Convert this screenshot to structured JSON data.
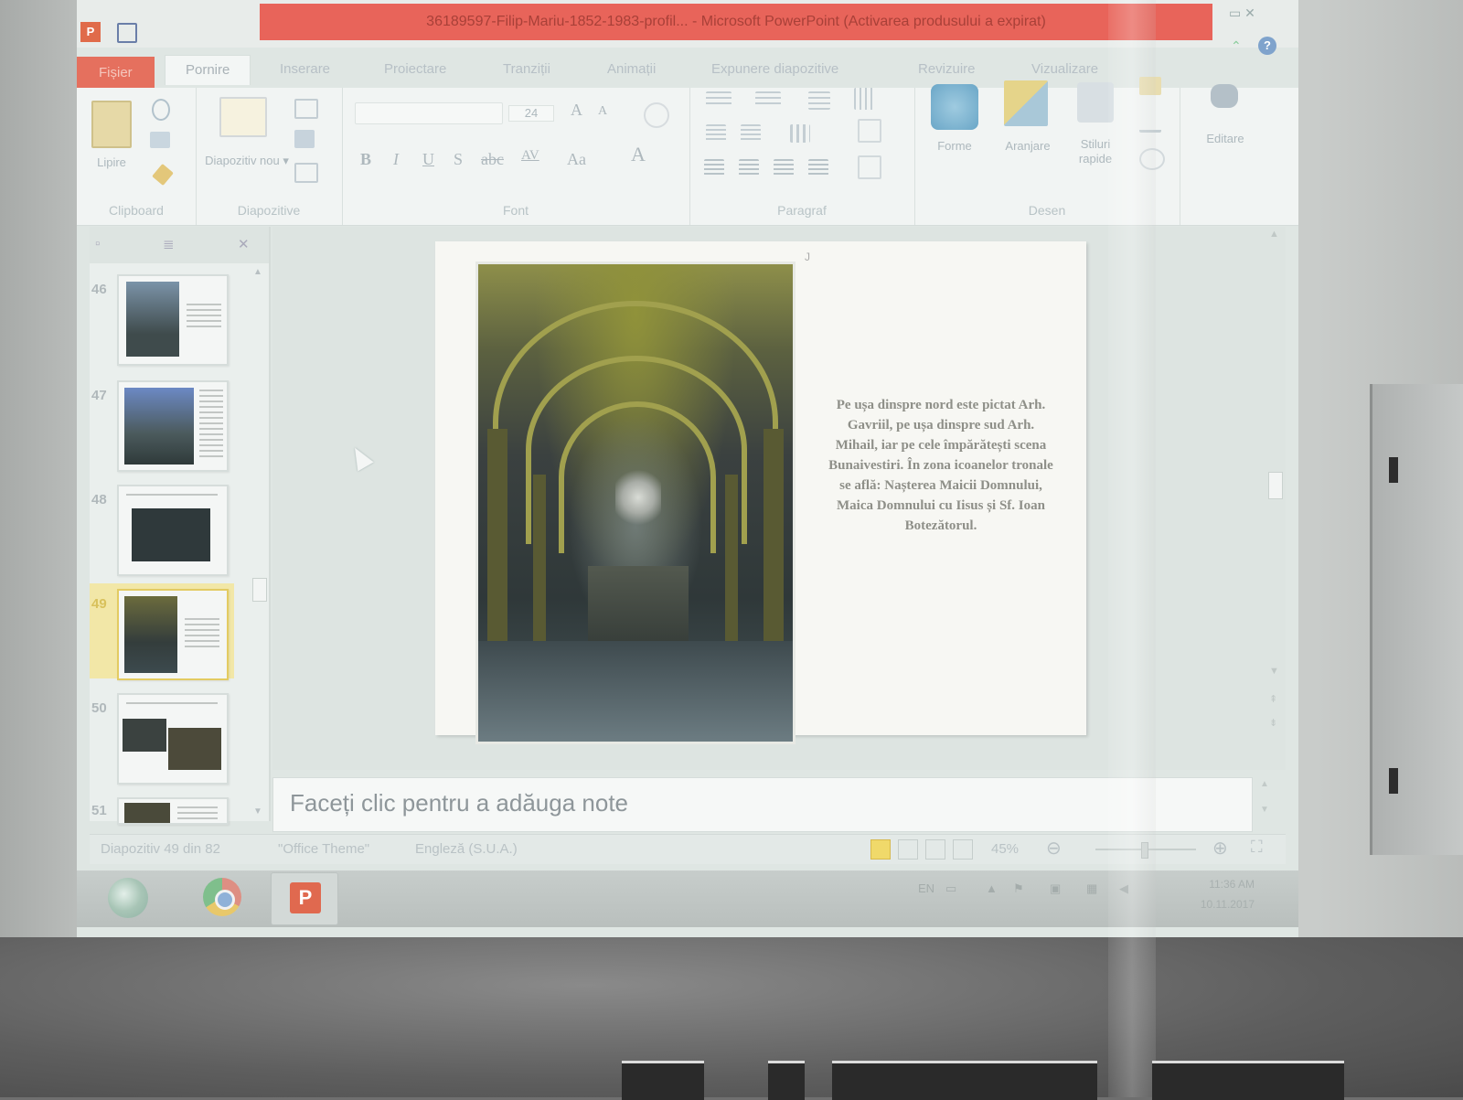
{
  "window": {
    "title": "36189597-Filip-Mariu-1852-1983-profil... - Microsoft PowerPoint (Activarea produsului a expirat)"
  },
  "ribbon_tabs": [
    {
      "label": "Fișier",
      "style": "file"
    },
    {
      "label": "Pornire",
      "style": "active"
    },
    {
      "label": "Inserare",
      "style": "normal"
    },
    {
      "label": "Proiectare",
      "style": "normal"
    },
    {
      "label": "Tranziții",
      "style": "normal"
    },
    {
      "label": "Animații",
      "style": "normal"
    },
    {
      "label": "Expunere diapozitive",
      "style": "normal"
    },
    {
      "label": "Revizuire",
      "style": "normal"
    },
    {
      "label": "Vizualizare",
      "style": "normal"
    }
  ],
  "ribbon": {
    "clipboard": {
      "label": "Clipboard",
      "paste": "Lipire"
    },
    "slides": {
      "label": "Diapozitive",
      "new_slide": "Diapozitiv nou ▾"
    },
    "font": {
      "label": "Font",
      "size": "24",
      "bold": "B",
      "italic": "I",
      "underline": "U",
      "strike": "S",
      "shadow": "abc",
      "spacing": "AV",
      "case": "Aa",
      "grow": "A",
      "shrink": "A",
      "color": "A"
    },
    "paragraph": {
      "label": "Paragraf"
    },
    "drawing": {
      "label": "Desen",
      "shapes": "Forme",
      "arrange": "Aranjare",
      "quick_styles": "Stiluri rapide"
    },
    "editing": {
      "label": "Editare"
    }
  },
  "thumbnails": [
    {
      "number": "46",
      "selected": false
    },
    {
      "number": "47",
      "selected": false
    },
    {
      "number": "48",
      "selected": false
    },
    {
      "number": "49",
      "selected": true
    },
    {
      "number": "50",
      "selected": false
    },
    {
      "number": "51",
      "selected": false
    }
  ],
  "slide": {
    "tiny_mark": "J",
    "text": "Pe ușa dinspre nord este pictat Arh. Gavriil, pe ușa dinspre sud Arh. Mihail, iar pe cele împărătești scena Bunaivestiri. În zona icoanelor tronale se află: Nașterea Maicii Domnului, Maica Domnului cu Iisus și Sf. Ioan Botezătorul."
  },
  "notes": {
    "placeholder": "Faceți clic pentru a adăuga note"
  },
  "statusbar": {
    "slide_position": "Diapozitiv 49 din 82",
    "theme": "\"Office Theme\"",
    "language": "Engleză (S.U.A.)",
    "zoom": "45%"
  },
  "taskbar": {
    "language": "EN",
    "clock_time": "11:36 AM",
    "clock_date": "10.11.2017",
    "ppt_label": "P"
  },
  "colors": {
    "accent_file_tab": "#e5705e",
    "title_bar_alert": "#e8645a",
    "selected_thumbnail": "#f2e7a7"
  }
}
